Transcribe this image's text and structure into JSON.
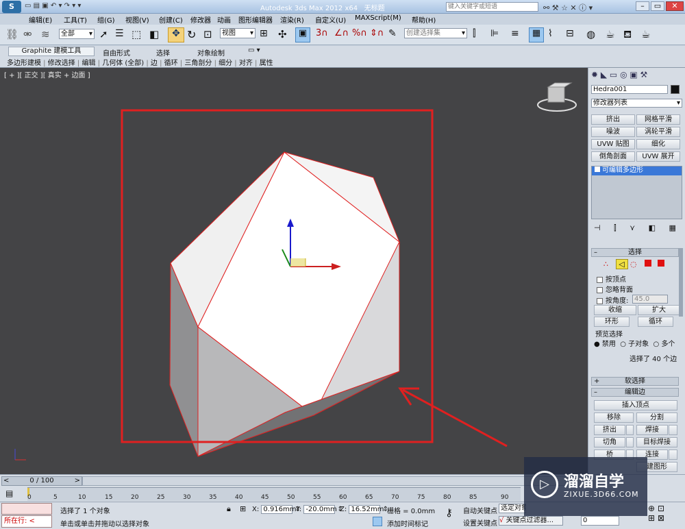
{
  "title": {
    "app": "Autodesk 3ds Max  2012 x64",
    "doc": "无标题",
    "search_placeholder": "键入关键字或短语"
  },
  "menus": [
    "编辑(E)",
    "工具(T)",
    "组(G)",
    "视图(V)",
    "创建(C)",
    "修改器",
    "动画",
    "图形编辑器",
    "渲染(R)",
    "自定义(U)",
    "MAXScript(M)",
    "帮助(H)"
  ],
  "toolbar": {
    "filter": "全部",
    "coord": "视图",
    "selset": "创建选择集"
  },
  "ribbon": {
    "tabs": [
      "Graphite 建模工具",
      "自由形式",
      "选择",
      "对象绘制"
    ],
    "items": [
      "多边形建模",
      "修改选择",
      "编辑",
      "几何体 (全部)",
      "边",
      "循环",
      "三角剖分",
      "细分",
      "对齐",
      "属性"
    ]
  },
  "viewport": {
    "label": "[ + ][ 正交 ][ 真实 + 边面 ]"
  },
  "cmd": {
    "object_name": "Hedra001",
    "modlist": "修改器列表",
    "mod_buttons": [
      "挤出",
      "网格平滑",
      "噪波",
      "涡轮平滑",
      "UVW 贴图",
      "细化",
      "倒角剖面",
      "UVW 展开"
    ],
    "stack_item": "可编辑多边形",
    "select_rollout": "选择",
    "by_vertex": "按顶点",
    "ignore_back": "忽略背面",
    "by_angle": "按角度:",
    "angle_val": "45.0",
    "shrink": "收缩",
    "grow": "扩大",
    "ring": "环形",
    "loop": "循环",
    "preview": "预览选择",
    "disabled": "禁用",
    "subobj": "子对象",
    "multi": "多个",
    "selected_info": "选择了 40 个边",
    "soft_sel": "软选择",
    "edit_edges": "编辑边",
    "insert_vertex": "插入顶点",
    "remove": "移除",
    "split": "分割",
    "extrude": "挤出",
    "weld": "焊接",
    "chamfer": "切角",
    "target_weld": "目标焊接",
    "bridge": "桥",
    "connect": "连接",
    "create_shape": "建图形"
  },
  "timeline": {
    "frame": "0 / 100",
    "ticks": [
      "0",
      "5",
      "10",
      "15",
      "20",
      "25",
      "30",
      "35",
      "40",
      "45",
      "50",
      "55",
      "60",
      "65",
      "70",
      "75",
      "80",
      "85",
      "90"
    ]
  },
  "status": {
    "mode": "所在行:",
    "msg1": "选择了 1 个对象",
    "msg2": "单击或单击并拖动以选择对象",
    "x": "0.916mm",
    "y": "-20.0mm",
    "z": "16.52mm",
    "grid": "栅格 = 0.0mm",
    "add_time": "添加时间标记",
    "autokey": "自动关键点",
    "selected": "选定对象",
    "setkey": "设置关键点",
    "keyfilter": "关键点过滤器...",
    "frame_val": "0"
  },
  "watermark": {
    "cn": "溜溜自学",
    "url": "ZIXUE.3D66.COM"
  },
  "colors": {
    "highlight": "#e02020",
    "viewport_bg": "#444446"
  }
}
